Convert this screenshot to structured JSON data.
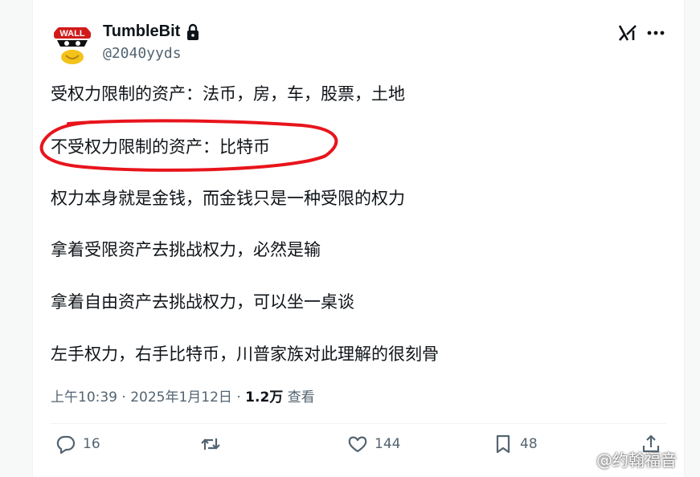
{
  "author": {
    "display_name": "TumbleBit",
    "handle": "@2040yyds",
    "avatar_text": "WALL"
  },
  "post": {
    "lines": [
      "受权力限制的资产：法币，房，车，股票，土地",
      "不受权力限制的资产：比特币",
      "权力本身就是金钱，而金钱只是一种受限的权力",
      "拿着受限资产去挑战权力，必然是输",
      "拿着自由资产去挑战权力，可以坐一桌谈",
      "左手权力，右手比特币，川普家族对此理解的很刻骨"
    ],
    "highlight_color": "#e8141c"
  },
  "meta": {
    "time": "上午10:39",
    "separator": "·",
    "date": "2025年1月12日",
    "views_count": "1.2万",
    "views_label": "查看"
  },
  "actions": {
    "reply_count": "16",
    "repost_count": "",
    "like_count": "144",
    "bookmark_count": "48"
  },
  "watermark": {
    "text": "@约翰福音"
  },
  "icons": [
    "lock-icon",
    "grok-icon",
    "more-icon",
    "reply-icon",
    "repost-icon",
    "like-icon",
    "bookmark-icon",
    "share-icon",
    "watermark-logo-icon"
  ],
  "colors": {
    "text": "#0f1419",
    "secondary": "#536471",
    "divider": "#eff3f4"
  }
}
